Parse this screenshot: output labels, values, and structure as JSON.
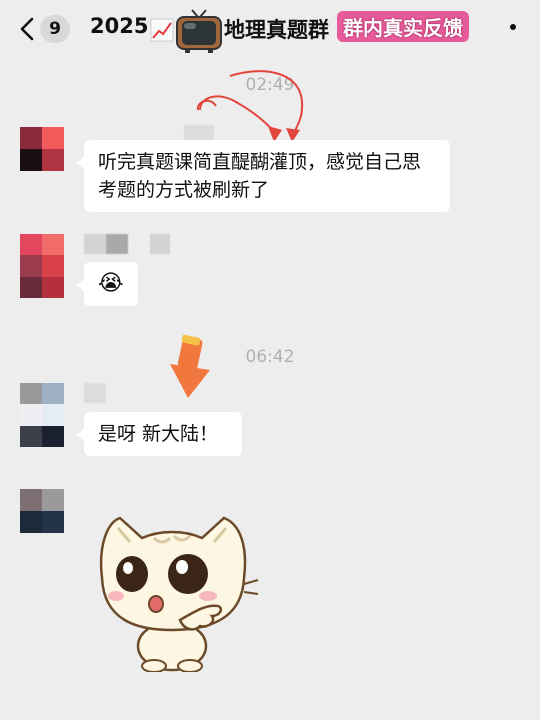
{
  "header": {
    "unread_count": "9",
    "title_prefix": "2025",
    "title_suffix": "地理真题群",
    "overlay_label": "群内真实反馈"
  },
  "timestamps": [
    "02:49",
    "06:42"
  ],
  "messages": [
    {
      "text": "听完真题课简直醍醐灌顶，感觉自己思考题的方式被刷新了"
    },
    {
      "text": "😭"
    },
    {
      "text": "是呀 新大陆！"
    }
  ],
  "icons": {
    "back": "chevron-left-icon",
    "more": "more-dots-icon",
    "tv": "tv-sticker-icon",
    "arrow_curved": "curved-arrow-annotation",
    "arrow_down": "down-arrow-sticker",
    "cat": "cat-sticker"
  },
  "colors": {
    "background": "#ededed",
    "bubble": "#ffffff",
    "overlay": "#e75b9a",
    "arrow": "#f0773d"
  }
}
